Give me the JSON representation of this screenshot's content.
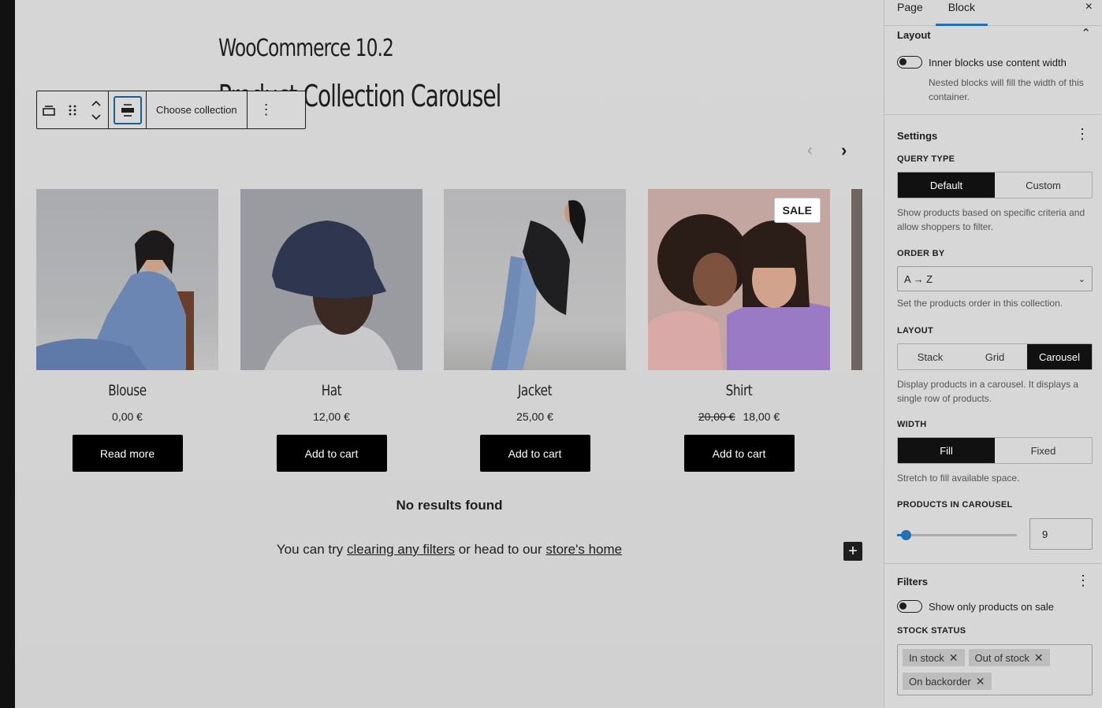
{
  "page": {
    "title": "WooCommerce 10.2",
    "subtitle": "Product Collection Carousel"
  },
  "toolbar": {
    "choose_collection": "Choose collection",
    "more": "⋮"
  },
  "carousel": {
    "prev": "‹",
    "next": "›"
  },
  "products": [
    {
      "name": "Blouse",
      "price": "0,00 €",
      "old_price": "",
      "button": "Read more"
    },
    {
      "name": "Hat",
      "price": "12,00 €",
      "old_price": "",
      "button": "Add to cart"
    },
    {
      "name": "Jacket",
      "price": "25,00 €",
      "old_price": "",
      "button": "Add to cart"
    },
    {
      "name": "Shirt",
      "price": "18,00 €",
      "old_price": "20,00 €",
      "button": "Add to cart",
      "badge": "SALE"
    }
  ],
  "empty_state": {
    "title": "No results found",
    "hint_prefix": "You can try ",
    "hint_link1": "clearing any filters",
    "hint_middle": " or head to our ",
    "hint_link2": "store's home"
  },
  "sidebar": {
    "tabs": [
      "Page",
      "Block"
    ],
    "close": "×",
    "layout_panel": {
      "title": "Layout",
      "toggle_label": "Inner blocks use content width",
      "help": "Nested blocks will fill the width of this container."
    },
    "settings_panel": {
      "title": "Settings",
      "query_type_label": "QUERY TYPE",
      "query_type_options": [
        "Default",
        "Custom"
      ],
      "query_type_selected": "Default",
      "query_type_help": "Show products based on specific criteria and allow shoppers to filter.",
      "order_by_label": "ORDER BY",
      "order_by_value": "A → Z",
      "order_by_help": "Set the products order in this collection.",
      "layout_label": "LAYOUT",
      "layout_options": [
        "Stack",
        "Grid",
        "Carousel"
      ],
      "layout_selected": "Carousel",
      "layout_help": "Display products in a carousel. It displays a single row of products.",
      "width_label": "WIDTH",
      "width_options": [
        "Fill",
        "Fixed"
      ],
      "width_selected": "Fill",
      "width_help": "Stretch to fill available space.",
      "products_label": "PRODUCTS IN CAROUSEL",
      "products_value": "9",
      "products_slider_fraction": 0.07
    },
    "filters_panel": {
      "title": "Filters",
      "sale_toggle_label": "Show only products on sale",
      "stock_label": "STOCK STATUS",
      "stock_tokens": [
        "In stock",
        "Out of stock",
        "On backorder"
      ]
    }
  },
  "colors": {
    "accent": "#2271b1",
    "button_bg": "#000000",
    "canvas_bg": "#d6d6d6"
  }
}
